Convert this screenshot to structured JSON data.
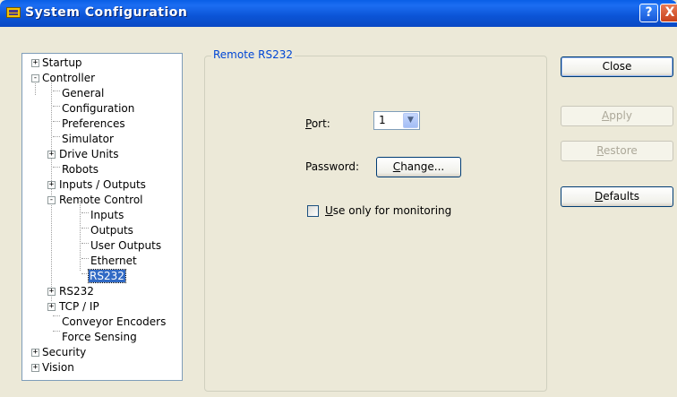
{
  "window": {
    "title": "System Configuration",
    "help_glyph": "?",
    "close_glyph": "X"
  },
  "tree": {
    "items": [
      {
        "label": "Startup",
        "toggle": "+"
      },
      {
        "label": "Controller",
        "toggle": "-"
      },
      {
        "label": "General"
      },
      {
        "label": "Configuration"
      },
      {
        "label": "Preferences"
      },
      {
        "label": "Simulator"
      },
      {
        "label": "Drive Units",
        "toggle": "+"
      },
      {
        "label": "Robots"
      },
      {
        "label": "Inputs / Outputs",
        "toggle": "+"
      },
      {
        "label": "Remote Control",
        "toggle": "-"
      },
      {
        "label": "Inputs"
      },
      {
        "label": "Outputs"
      },
      {
        "label": "User Outputs"
      },
      {
        "label": "Ethernet"
      },
      {
        "label": "RS232",
        "selected": true
      },
      {
        "label": "RS232",
        "toggle": "+"
      },
      {
        "label": "TCP / IP",
        "toggle": "+"
      },
      {
        "label": "Conveyor Encoders"
      },
      {
        "label": "Force Sensing"
      },
      {
        "label": "Security",
        "toggle": "+"
      },
      {
        "label": "Vision",
        "toggle": "+"
      }
    ]
  },
  "panel": {
    "group_title": "Remote RS232",
    "port_label_key": "P",
    "port_label_rest": "ort:",
    "port_value": "1",
    "password_label": "Password:",
    "change_key": "C",
    "change_rest": "hange...",
    "monitor_key": "U",
    "monitor_rest": "se only for monitoring",
    "monitor_checked": false
  },
  "buttons": {
    "close": "Close",
    "apply_key": "A",
    "apply_rest": "pply",
    "restore_key": "R",
    "restore_rest": "estore",
    "defaults_key": "D",
    "defaults_rest": "efaults"
  }
}
